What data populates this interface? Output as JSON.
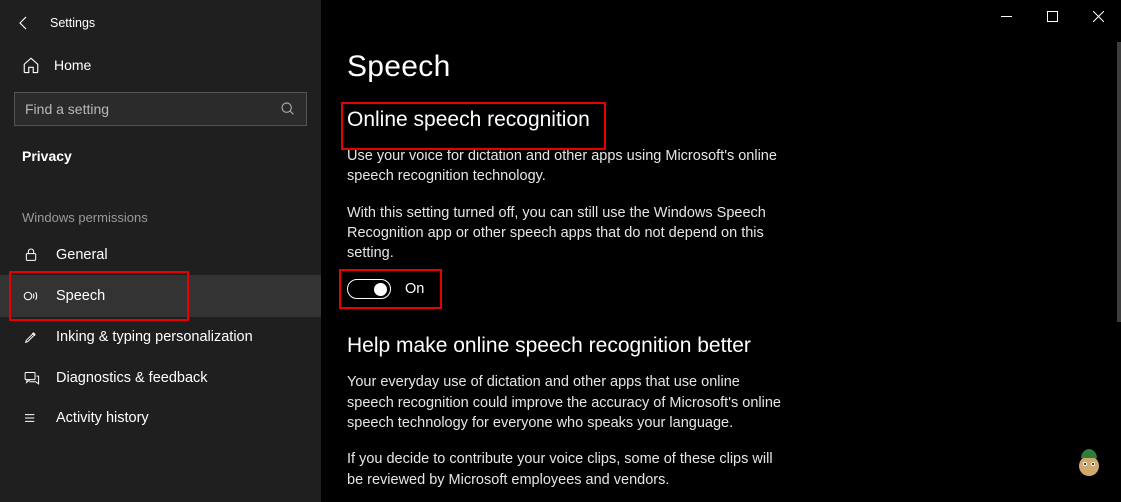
{
  "header": {
    "window_title": "Settings"
  },
  "sidebar": {
    "home_label": "Home",
    "search_placeholder": "Find a setting",
    "category_label": "Privacy",
    "group_label": "Windows permissions",
    "items": [
      {
        "label": "General",
        "icon": "lock-icon"
      },
      {
        "label": "Speech",
        "icon": "speech-icon"
      },
      {
        "label": "Inking & typing personalization",
        "icon": "pen-icon"
      },
      {
        "label": "Diagnostics & feedback",
        "icon": "feedback-icon"
      },
      {
        "label": "Activity history",
        "icon": "history-icon"
      }
    ]
  },
  "main": {
    "title": "Speech",
    "section1_title": "Online speech recognition",
    "section1_desc": "Use your voice for dictation and other apps using Microsoft's online speech recognition technology.",
    "section1_note": "With this setting turned off, you can still use the Windows Speech Recognition app or other speech apps that do not depend on this setting.",
    "toggle_label": "On",
    "section2_title": "Help make online speech recognition better",
    "section2_desc": "Your everyday use of dictation and other apps that use online speech recognition could improve the accuracy of Microsoft's online speech technology for everyone who speaks your language.",
    "section2_note": "If you decide to contribute your voice clips, some of these clips will be reviewed by Microsoft employees and vendors."
  }
}
